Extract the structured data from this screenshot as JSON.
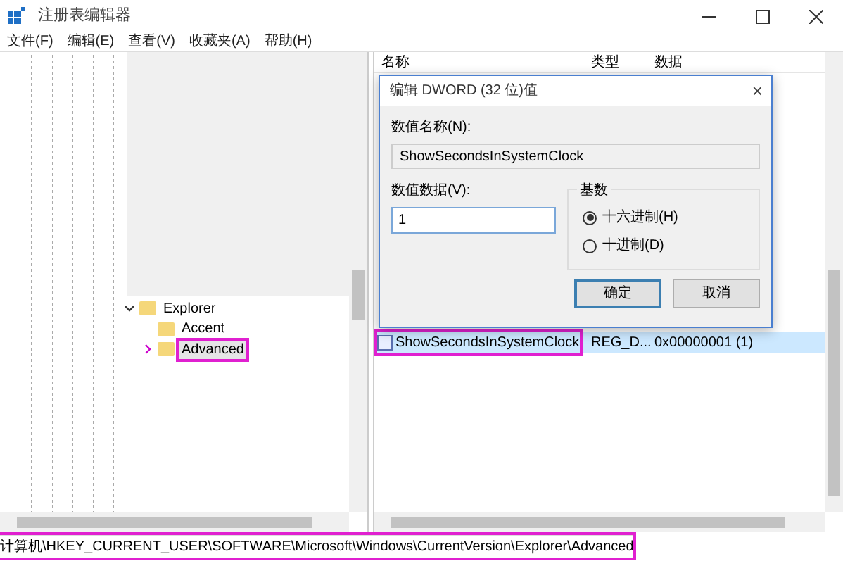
{
  "window": {
    "title": "注册表编辑器"
  },
  "menu": [
    "文件(F)",
    "编辑(E)",
    "查看(V)",
    "收藏夹(A)",
    "帮助(H)"
  ],
  "tree": {
    "items": [
      {
        "label": "Explorer",
        "expanded": true,
        "selected": false,
        "annotated": false,
        "children": [
          {
            "label": "Accent",
            "selected": false,
            "annotated": false
          },
          {
            "label": "Advanced",
            "selected": true,
            "annotated": true,
            "expanded": false
          }
        ]
      }
    ]
  },
  "list": {
    "columns": [
      "名称",
      "类型",
      "数据"
    ],
    "rows": [
      {
        "name": "ShowSecondsInSystemClock",
        "type": "REG_D...",
        "data": "0x00000001 (1)",
        "selected": true,
        "annotated": true
      }
    ]
  },
  "dialog": {
    "title": "编辑 DWORD (32 位)值",
    "close": "×",
    "name_label": "数值名称(N):",
    "name_value": "ShowSecondsInSystemClock",
    "data_label": "数值数据(V):",
    "data_value": "1",
    "base": {
      "label": "基数",
      "options": [
        {
          "label": "十六进制(H)",
          "selected": true
        },
        {
          "label": "十进制(D)",
          "selected": false
        }
      ]
    },
    "buttons": [
      {
        "label": "确定",
        "default": true
      },
      {
        "label": "取消",
        "default": false
      }
    ]
  },
  "status_bar": {
    "path": "计算机\\HKEY_CURRENT_USER\\SOFTWARE\\Microsoft\\Windows\\CurrentVersion\\Explorer\\Advanced",
    "annotated": true
  }
}
